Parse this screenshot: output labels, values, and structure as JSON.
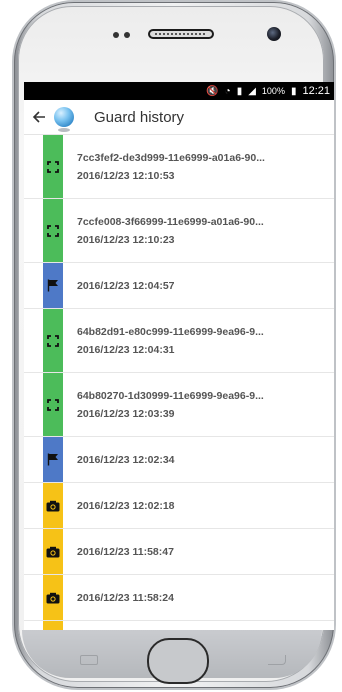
{
  "status_bar": {
    "time": "12:21",
    "battery": "100%",
    "icons": [
      "mute-icon",
      "wifi-icon",
      "sim-icon",
      "signal-icon",
      "battery-icon"
    ]
  },
  "app_bar": {
    "title": "Guard history",
    "back_icon": "back-arrow-icon",
    "app_icon": "globe-icon"
  },
  "colors": {
    "scan": "#4cbc5a",
    "flag": "#4e79c7",
    "photo": "#f6c217"
  },
  "history": [
    {
      "type": "scan",
      "icon": "scan-icon",
      "title": "7cc3fef2-de3d999-11e6999-a01a6-90...",
      "time": "2016/12/23 12:10:53"
    },
    {
      "type": "scan",
      "icon": "scan-icon",
      "title": "7ccfe008-3f66999-11e6999-a01a6-90...",
      "time": "2016/12/23 12:10:23"
    },
    {
      "type": "flag",
      "icon": "flag-icon",
      "title": "",
      "time": "2016/12/23 12:04:57"
    },
    {
      "type": "scan",
      "icon": "scan-icon",
      "title": "64b82d91-e80c999-11e6999-9ea96-9...",
      "time": "2016/12/23 12:04:31"
    },
    {
      "type": "scan",
      "icon": "scan-icon",
      "title": "64b80270-1d30999-11e6999-9ea96-9...",
      "time": "2016/12/23 12:03:39"
    },
    {
      "type": "flag",
      "icon": "flag-icon",
      "title": "",
      "time": "2016/12/23 12:02:34"
    },
    {
      "type": "photo",
      "icon": "camera-icon",
      "title": "",
      "time": "2016/12/23 12:02:18"
    },
    {
      "type": "photo",
      "icon": "camera-icon",
      "title": "",
      "time": "2016/12/23 11:58:47"
    },
    {
      "type": "photo",
      "icon": "camera-icon",
      "title": "",
      "time": "2016/12/23 11:58:24"
    }
  ]
}
